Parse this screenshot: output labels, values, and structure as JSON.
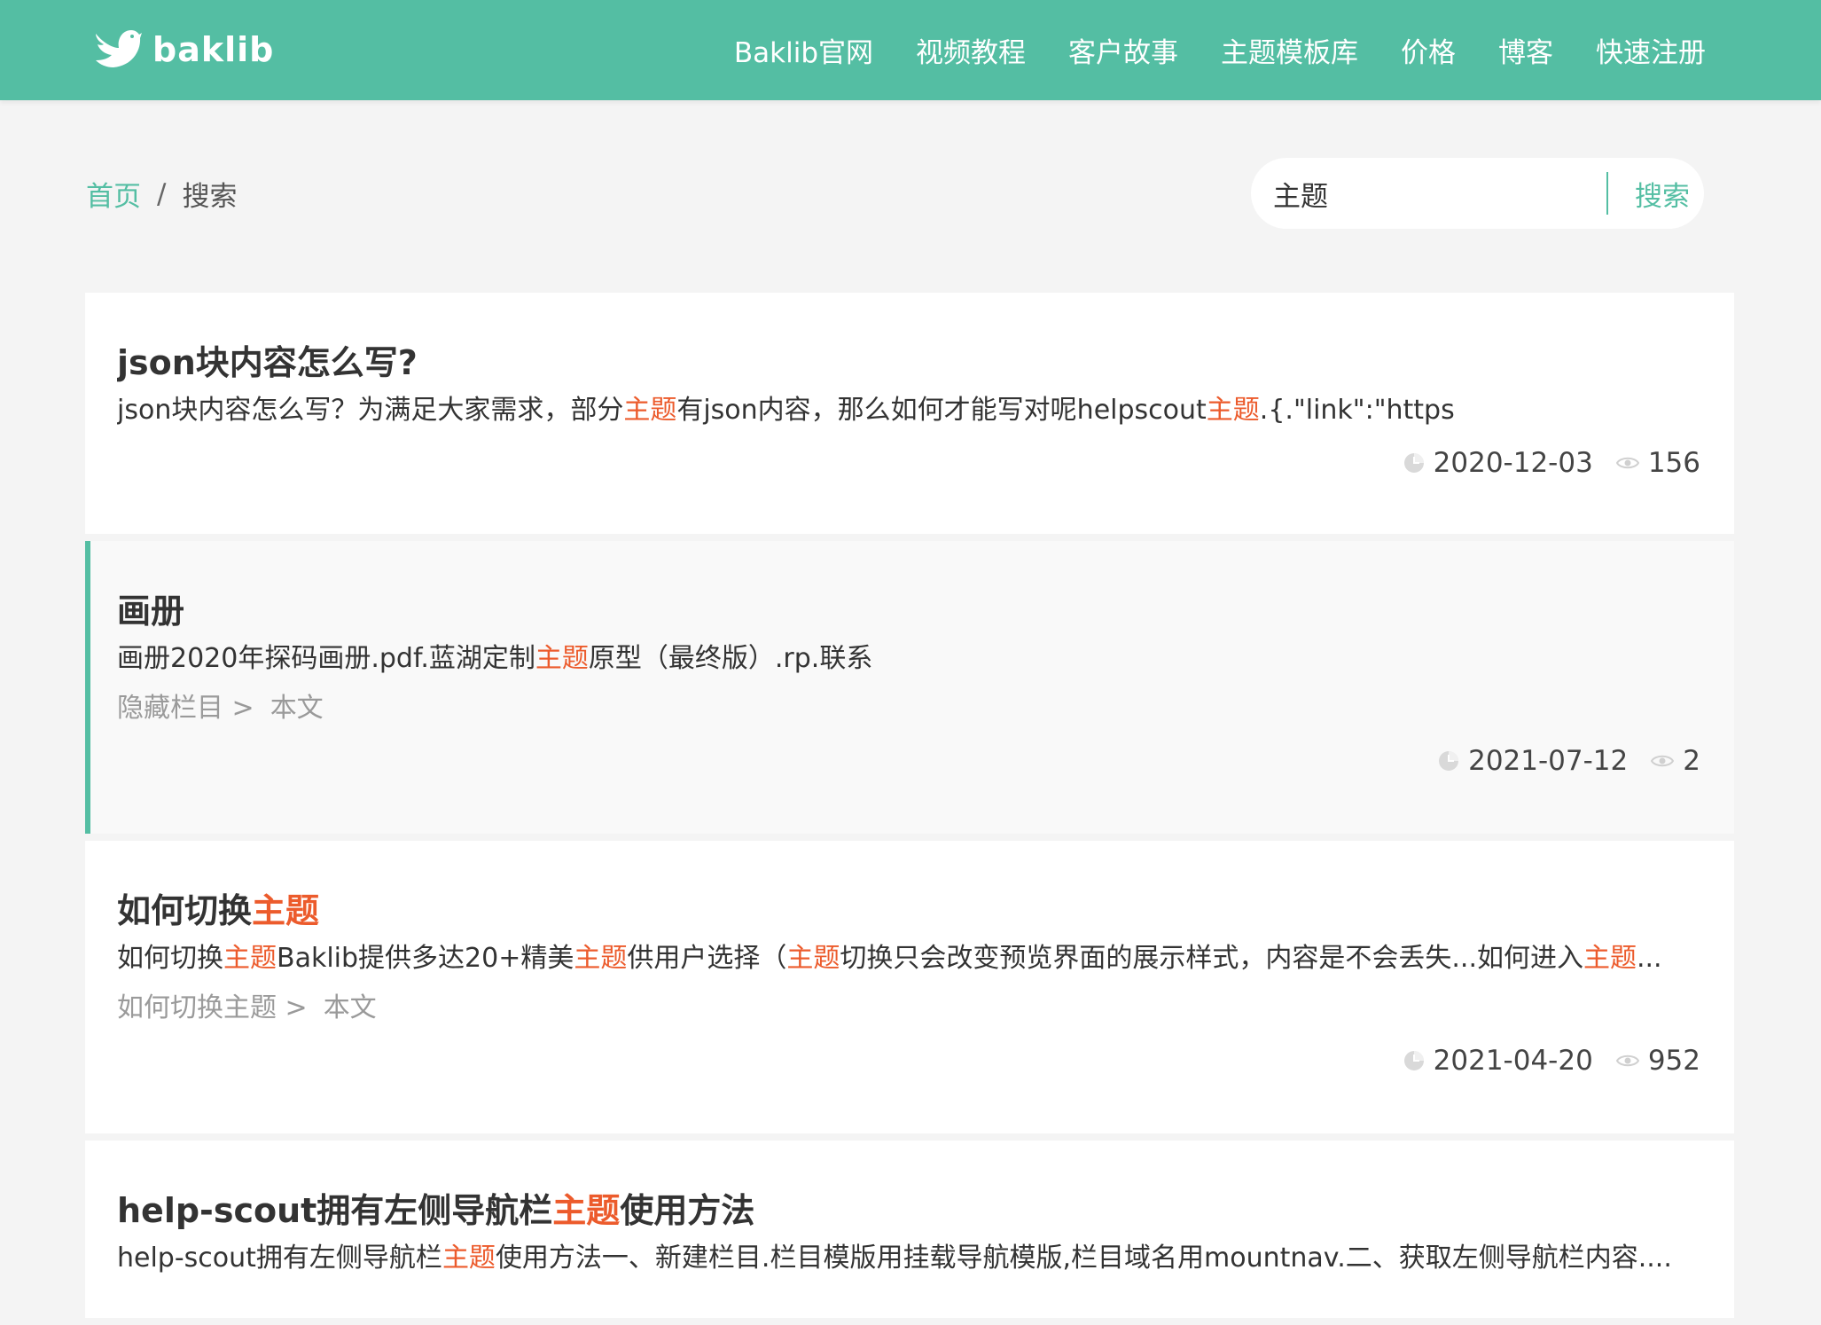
{
  "header": {
    "logo_text": "baklib",
    "nav": [
      "Baklib官网",
      "视频教程",
      "客户故事",
      "主题模板库",
      "价格",
      "博客",
      "快速注册"
    ]
  },
  "breadcrumb": {
    "home": "首页",
    "separator": "/",
    "current": "搜索"
  },
  "search": {
    "query": "主题",
    "button": "搜索"
  },
  "results": [
    {
      "title": [
        "json块内容怎么写?"
      ],
      "excerpt": [
        "json块内容怎么写？为满足大家需求，部分",
        "主题",
        "有json内容，那么如何才能写对呢helpscout",
        "主题",
        ".{.\"link\":\"https"
      ],
      "path": null,
      "date": "2020-12-03",
      "views": "156"
    },
    {
      "title": [
        "画册"
      ],
      "excerpt": [
        "画册2020年探码画册.pdf.蓝湖定制",
        "主题",
        "原型（最终版）.rp.联系"
      ],
      "path": {
        "parent": "隐藏栏目 >",
        "page": "本文"
      },
      "date": "2021-07-12",
      "views": "2"
    },
    {
      "title": [
        "如何切换",
        "主题"
      ],
      "excerpt": [
        "如何切换",
        "主题",
        "Baklib提供多达20+精美",
        "主题",
        "供用户选择（",
        "主题",
        "切换只会改变预览界面的展示样式，内容是不会丢失...如何进入",
        "主题",
        "..."
      ],
      "path": {
        "parent": "如何切换主题 >",
        "page": "本文"
      },
      "date": "2021-04-20",
      "views": "952"
    },
    {
      "title": [
        "help-scout拥有左侧导航栏",
        "主题",
        "使用方法"
      ],
      "excerpt": [
        "help-scout拥有左侧导航栏",
        "主题",
        "使用方法一、新建栏目.栏目模版用挂载导航模版,栏目域名用mountnav.二、获取左侧导航栏内容...."
      ],
      "path": null,
      "date": "",
      "views": ""
    }
  ],
  "colors": {
    "brand": "#54bea3",
    "highlight": "#ec5b2c",
    "background": "#f4f4f4"
  },
  "icons": {
    "logo": "bird-logo-icon",
    "date": "clock-icon",
    "views": "eye-icon"
  }
}
